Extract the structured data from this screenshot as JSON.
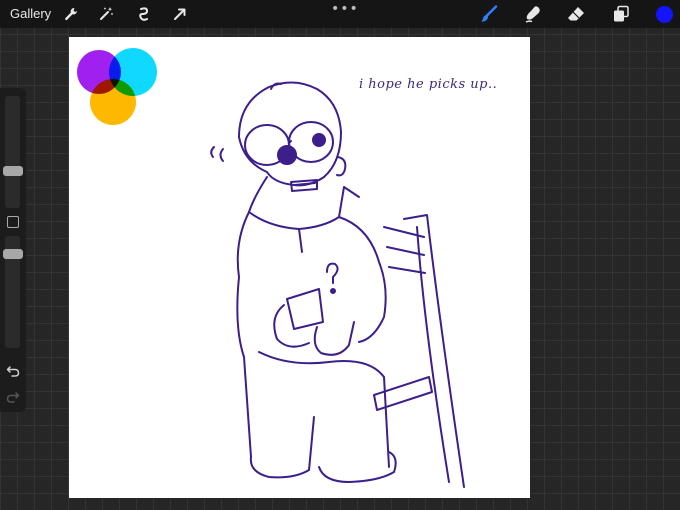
{
  "topbar": {
    "gallery_label": "Gallery",
    "more_label": "•••",
    "tools": [
      "wrench-icon",
      "magic-wand-icon",
      "selection-icon",
      "transform-arrow-icon",
      "brush-icon",
      "smudge-icon",
      "eraser-icon",
      "layers-icon"
    ],
    "active_tool": "brush",
    "current_color": "#1414ff"
  },
  "canvas": {
    "caption": "i hope he picks up..",
    "venn_colors": [
      "#a020f0",
      "#10d8ff",
      "#ffb800"
    ],
    "ink_color": "#3d1f8c"
  },
  "sidebar": {
    "undo_icon": "undo-icon",
    "redo_icon": "redo-icon"
  }
}
